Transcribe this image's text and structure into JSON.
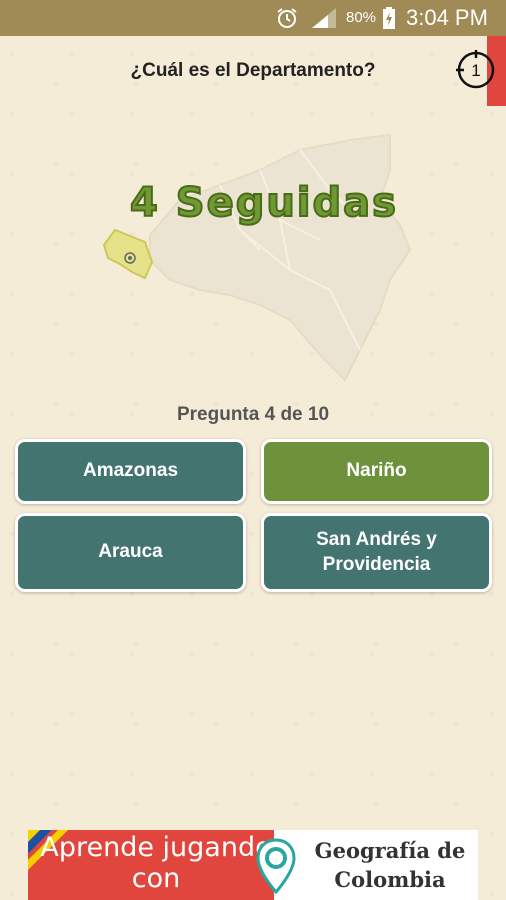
{
  "status_bar": {
    "battery_percent": "80%",
    "time": "3:04 PM"
  },
  "header": {
    "question": "¿Cuál es el Departamento?",
    "timer_value": "1"
  },
  "streak_label": "4 Seguidas",
  "progress_text": "Pregunta 4 de 10",
  "answers": [
    {
      "label": "Amazonas",
      "state": "default"
    },
    {
      "label": "Nariño",
      "state": "highlighted"
    },
    {
      "label": "Arauca",
      "state": "default"
    },
    {
      "label": "San Andrés y Providencia",
      "state": "default"
    }
  ],
  "ad": {
    "left_text": "Aprende jugando con",
    "right_text": "Geografía de Colombia"
  },
  "colors": {
    "status_bar": "#a08a55",
    "button_default": "#437470",
    "button_highlight": "#6e923b",
    "accent_red": "#e0453e"
  }
}
